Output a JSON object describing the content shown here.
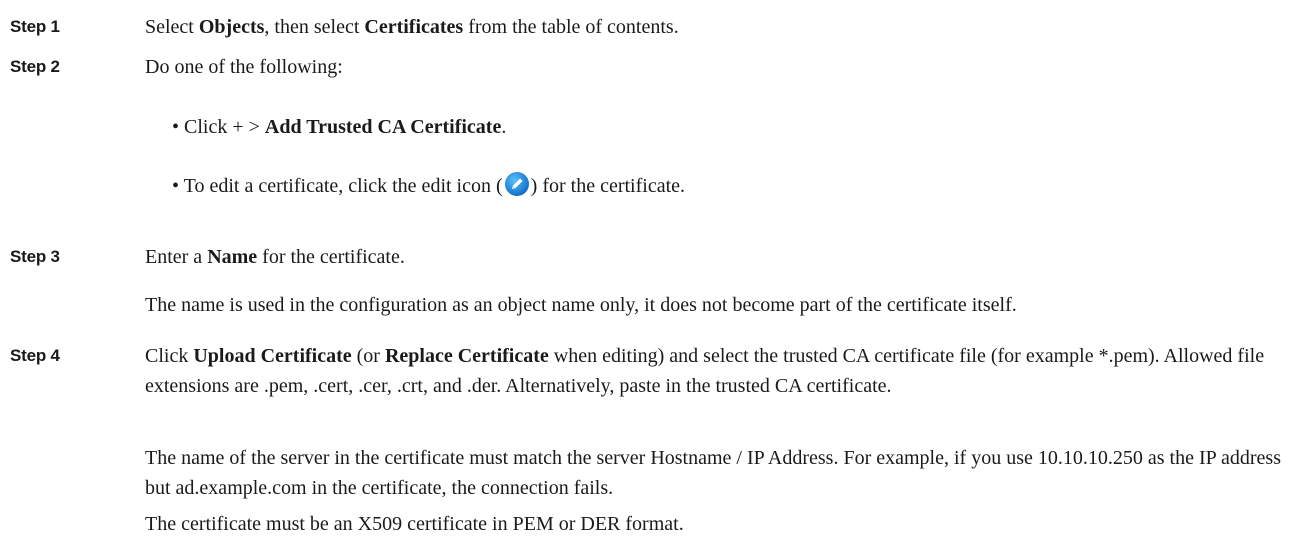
{
  "steps": [
    {
      "label": "Step 1",
      "parts": [
        {
          "text": "Select ",
          "bold": false
        },
        {
          "text": "Objects",
          "bold": true
        },
        {
          "text": ", then select ",
          "bold": false
        },
        {
          "text": "Certificates",
          "bold": true
        },
        {
          "text": " from the table of contents.",
          "bold": false
        }
      ]
    },
    {
      "label": "Step 2",
      "intro": "Do one of the following:",
      "bullets": [
        {
          "prefix": "• Click + > ",
          "bold": "Add Trusted CA Certificate",
          "suffix": "."
        },
        {
          "before_icon": "• To edit a certificate, click the edit icon (",
          "icon": "edit-icon",
          "after_icon": ") for the certificate."
        }
      ]
    },
    {
      "label": "Step 3",
      "parts": [
        {
          "text": "Enter a ",
          "bold": false
        },
        {
          "text": "Name",
          "bold": true
        },
        {
          "text": " for the certificate.",
          "bold": false
        }
      ],
      "note": "The name is used in the configuration as an object name only, it does not become part of the certificate itself."
    },
    {
      "label": "Step 4",
      "parts": [
        {
          "text": "Click ",
          "bold": false
        },
        {
          "text": "Upload Certificate",
          "bold": true
        },
        {
          "text": " (or ",
          "bold": false
        },
        {
          "text": "Replace Certificate",
          "bold": true
        },
        {
          "text": " when editing) and select the trusted CA certificate file (for example *.pem). Allowed file extensions are .pem, .cert, .cer, .crt, and .der. Alternatively, paste in the trusted CA certificate.",
          "bold": false
        }
      ],
      "note1": "The name of the server in the certificate must match the server Hostname / IP Address. For example, if you use 10.10.10.250 as the IP address but ad.example.com in the certificate, the connection fails.",
      "note2": "The certificate must be an X509 certificate in PEM or DER format."
    }
  ],
  "colors": {
    "text": "#1a1a1a",
    "icon_blue": "#1e8fe0"
  }
}
